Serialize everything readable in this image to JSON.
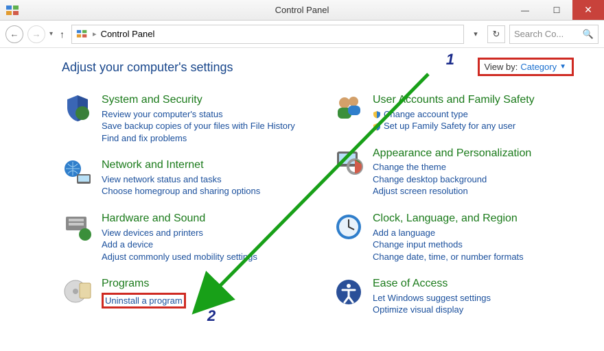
{
  "window": {
    "title": "Control Panel"
  },
  "address": {
    "location": "Control Panel"
  },
  "search": {
    "placeholder": "Search Co..."
  },
  "heading": "Adjust your computer's settings",
  "viewby": {
    "label": "View by:",
    "value": "Category"
  },
  "annotations": {
    "one": "1",
    "two": "2"
  },
  "cats": {
    "sys": {
      "title": "System and Security",
      "l1": "Review your computer's status",
      "l2": "Save backup copies of your files with File History",
      "l3": "Find and fix problems"
    },
    "net": {
      "title": "Network and Internet",
      "l1": "View network status and tasks",
      "l2": "Choose homegroup and sharing options"
    },
    "hw": {
      "title": "Hardware and Sound",
      "l1": "View devices and printers",
      "l2": "Add a device",
      "l3": "Adjust commonly used mobility settings"
    },
    "prog": {
      "title": "Programs",
      "l1": "Uninstall a program"
    },
    "user": {
      "title": "User Accounts and Family Safety",
      "l1": "Change account type",
      "l2": "Set up Family Safety for any user"
    },
    "app": {
      "title": "Appearance and Personalization",
      "l1": "Change the theme",
      "l2": "Change desktop background",
      "l3": "Adjust screen resolution"
    },
    "clk": {
      "title": "Clock, Language, and Region",
      "l1": "Add a language",
      "l2": "Change input methods",
      "l3": "Change date, time, or number formats"
    },
    "ease": {
      "title": "Ease of Access",
      "l1": "Let Windows suggest settings",
      "l2": "Optimize visual display"
    }
  }
}
